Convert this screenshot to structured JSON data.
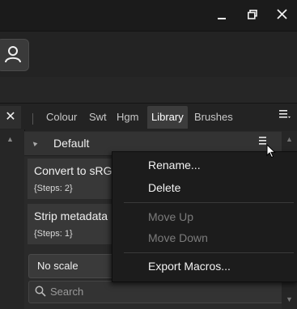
{
  "titlebar": {
    "minimize_glyph": "▁",
    "restore_glyph": "❐",
    "close_glyph": "✕"
  },
  "toolbar": {
    "user_icon": "user-icon"
  },
  "left_panel": {
    "close_glyph": "✕"
  },
  "tabs": [
    {
      "label": "Colour"
    },
    {
      "label": "Swt"
    },
    {
      "label": "Hgm"
    },
    {
      "label": "Library",
      "active": true
    },
    {
      "label": "Brushes"
    }
  ],
  "panel_menu_glyph": "≡",
  "library": {
    "group_name": "Default",
    "collapse_glyph": "▲",
    "group_menu_glyph": "≡",
    "macros": [
      {
        "name": "Convert to sRGB",
        "steps": "{Steps: 2}"
      },
      {
        "name": "Strip metadata",
        "steps": "{Steps: 1}"
      }
    ],
    "scale_value": "No scale",
    "search_placeholder": "Search"
  },
  "context_menu": {
    "items": [
      {
        "label": "Rename...",
        "enabled": true
      },
      {
        "label": "Delete",
        "enabled": true
      },
      {
        "label": "Move Up",
        "enabled": false
      },
      {
        "label": "Move Down",
        "enabled": false
      },
      {
        "label": "Export Macros...",
        "enabled": true
      }
    ]
  },
  "colors": {
    "background": "#1e1e1e",
    "panel": "#2a2a2a",
    "menu": "#1c1c1c",
    "active_tab": "#3c3c3c",
    "disabled_text": "#7c7c7c"
  }
}
